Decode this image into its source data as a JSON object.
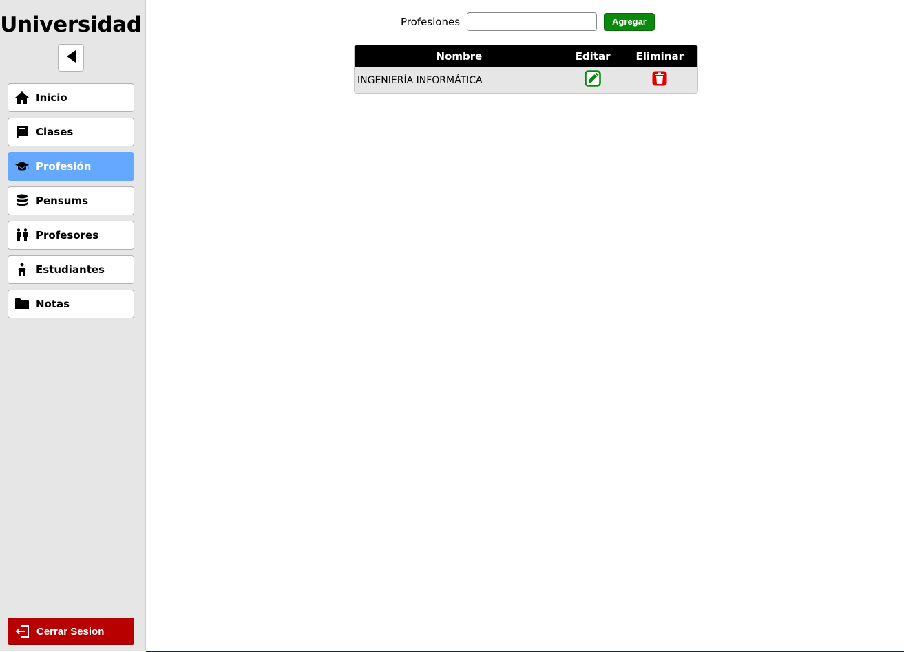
{
  "sidebar": {
    "brand": "Universidad",
    "collapse_icon": "caret-left-icon",
    "items": [
      {
        "label": "Inicio",
        "icon": "home-icon",
        "active": false
      },
      {
        "label": "Clases",
        "icon": "book-icon",
        "active": false
      },
      {
        "label": "Profesión",
        "icon": "graduation-cap-icon",
        "active": true
      },
      {
        "label": "Pensums",
        "icon": "database-icon",
        "active": false
      },
      {
        "label": "Profesores",
        "icon": "people-icon",
        "active": false
      },
      {
        "label": "Estudiantes",
        "icon": "child-icon",
        "active": false
      },
      {
        "label": "Notas",
        "icon": "folder-icon",
        "active": false
      }
    ],
    "logout_label": "Cerrar Sesion",
    "logout_icon": "sign-out-icon"
  },
  "form": {
    "label": "Profesiones",
    "input_value": "",
    "add_label": "Agregar"
  },
  "table": {
    "headers": [
      "Nombre",
      "Editar",
      "Eliminar"
    ],
    "rows": [
      {
        "nombre": "INGENIERÍA INFORMÁTICA"
      }
    ]
  },
  "colors": {
    "active_nav": "#64a8ff",
    "add_button": "#0a8a0a",
    "logout_button": "#b80000",
    "edit_icon": "#0a8a0a",
    "delete_icon": "#e00000"
  }
}
